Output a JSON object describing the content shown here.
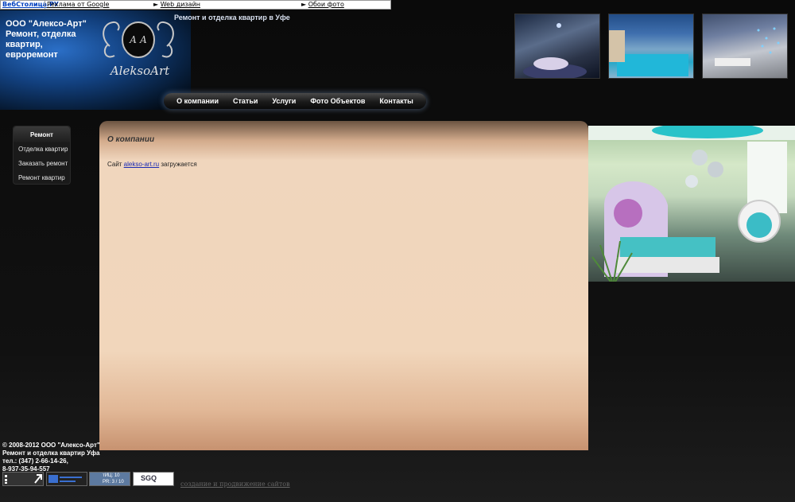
{
  "adbar": {
    "brand": "ВебСтолица.РУ",
    "google": "Реклама от Google",
    "link1": "Web дизайн",
    "link2": "Обои фото"
  },
  "header": {
    "company_lines": [
      "ООО \"Алексо-Арт\"",
      "Ремонт, отделка",
      "квартир,",
      "евроремонт"
    ],
    "logo_text": "AleksoArt",
    "logo_monogram": "А А",
    "tagline": "Ремонт и отделка квартир в Уфе"
  },
  "nav": {
    "items": [
      "О компании",
      "Статьи",
      "Услуги",
      "Фото Объектов",
      "Контакты"
    ]
  },
  "sidebar": {
    "title": "Ремонт",
    "items": [
      "Отделка квартир",
      "Заказать ремонт",
      "Ремонт квартир"
    ]
  },
  "content": {
    "title": "О компании",
    "text_prefix": "Сайт ",
    "link": "alekso-art.ru",
    "text_suffix": " загружается"
  },
  "footer": {
    "lines": [
      "© 2008-2012 ООО \"Алексо-Арт\"",
      "Ремонт и отделка квартир Уфа",
      "тел.: (347) 2-66-14-26,",
      "8-937-35-94-557"
    ],
    "tic": "тИЦ: 10",
    "pr": "PR: 3 / 10",
    "sgq": "SGQ",
    "promo": "создание и продвижение сайтов"
  },
  "colors": {
    "accent": "#2b6fc7",
    "content_bg": "#f0d6bd",
    "link": "#1a2bb4"
  }
}
